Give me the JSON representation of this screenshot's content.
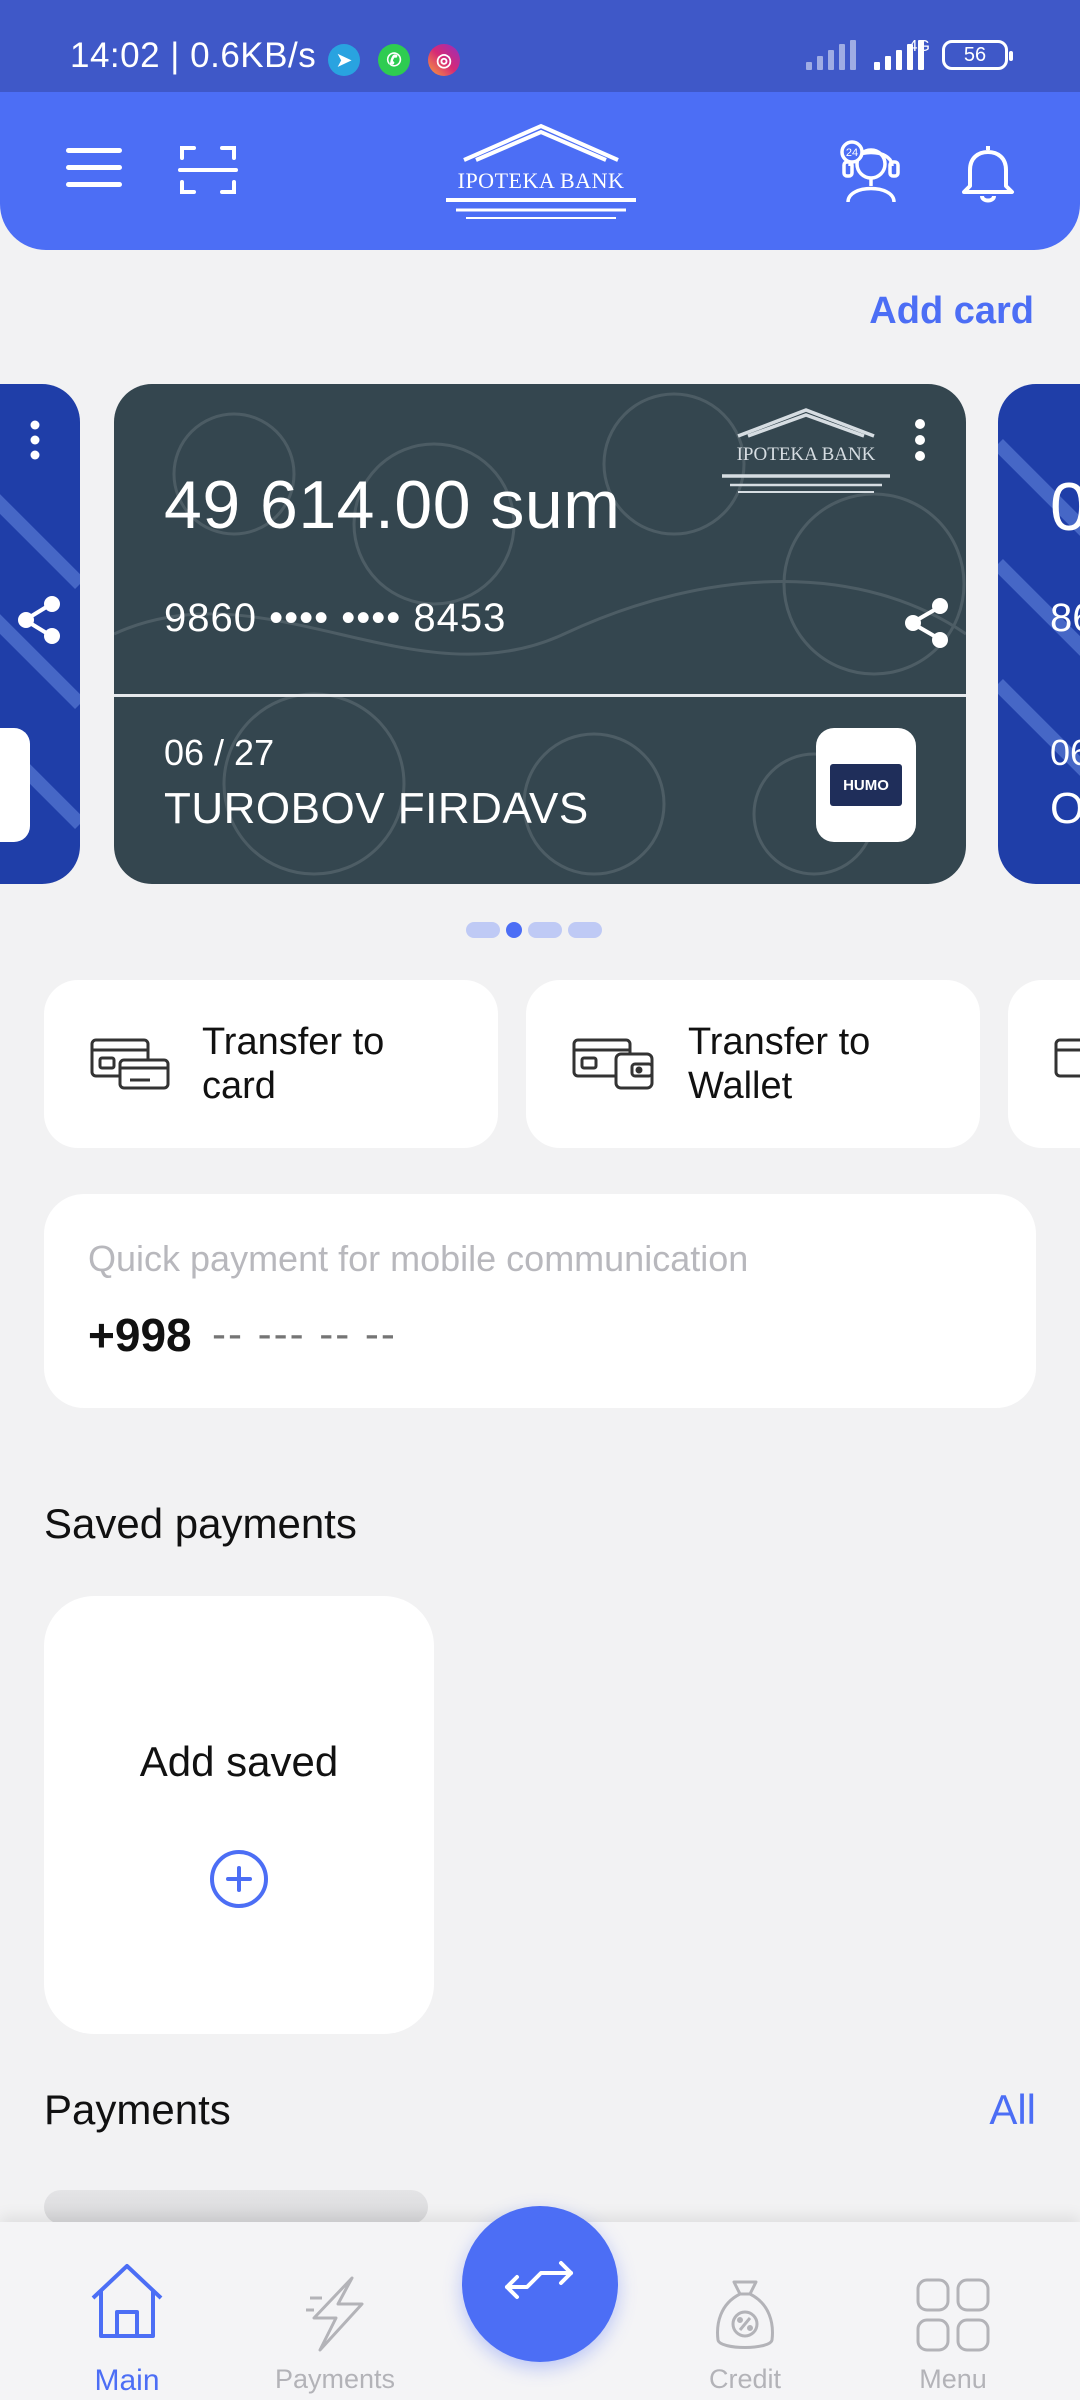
{
  "status_bar": {
    "time": "14:02 | 0.6KB/s",
    "network": "4G",
    "battery": "56"
  },
  "header": {
    "logo_text": "IPOTEKA BANK",
    "icons": [
      "menu-icon",
      "scan-icon",
      "support-24-icon",
      "bell-icon"
    ]
  },
  "add_card_label": "Add card",
  "card": {
    "balance": "49 614.00 sum",
    "number": "9860 •••• •••• 8453",
    "expiry": "06 / 27",
    "holder": "TUROBOV FIRDAVS",
    "bank_logo_text": "IPOTEKA BANK",
    "payment_system": "HUMO",
    "side_right_balance": "0",
    "side_right_number": "86",
    "side_right_expiry": "06",
    "side_right_holder": "O"
  },
  "carousel": {
    "count": 4,
    "active_index": 1
  },
  "transfers": [
    {
      "label": "Transfer to card"
    },
    {
      "label": "Transfer to Wallet"
    }
  ],
  "quick_payment": {
    "title": "Quick payment for mobile communication",
    "prefix": "+998",
    "placeholder": "-- --- -- --"
  },
  "saved_payments": {
    "title": "Saved payments",
    "add_label": "Add saved"
  },
  "payments": {
    "title": "Payments",
    "all_label": "All"
  },
  "bottom_nav": {
    "items": [
      {
        "label": "Main",
        "active": true
      },
      {
        "label": "Payments",
        "active": false
      },
      {
        "label": "Credit",
        "active": false
      },
      {
        "label": "Menu",
        "active": false
      }
    ]
  },
  "colors": {
    "primary": "#4c6ef5",
    "status_bar": "#3f58c8",
    "card_bg": "#34464f",
    "background": "#f2f2f3"
  }
}
